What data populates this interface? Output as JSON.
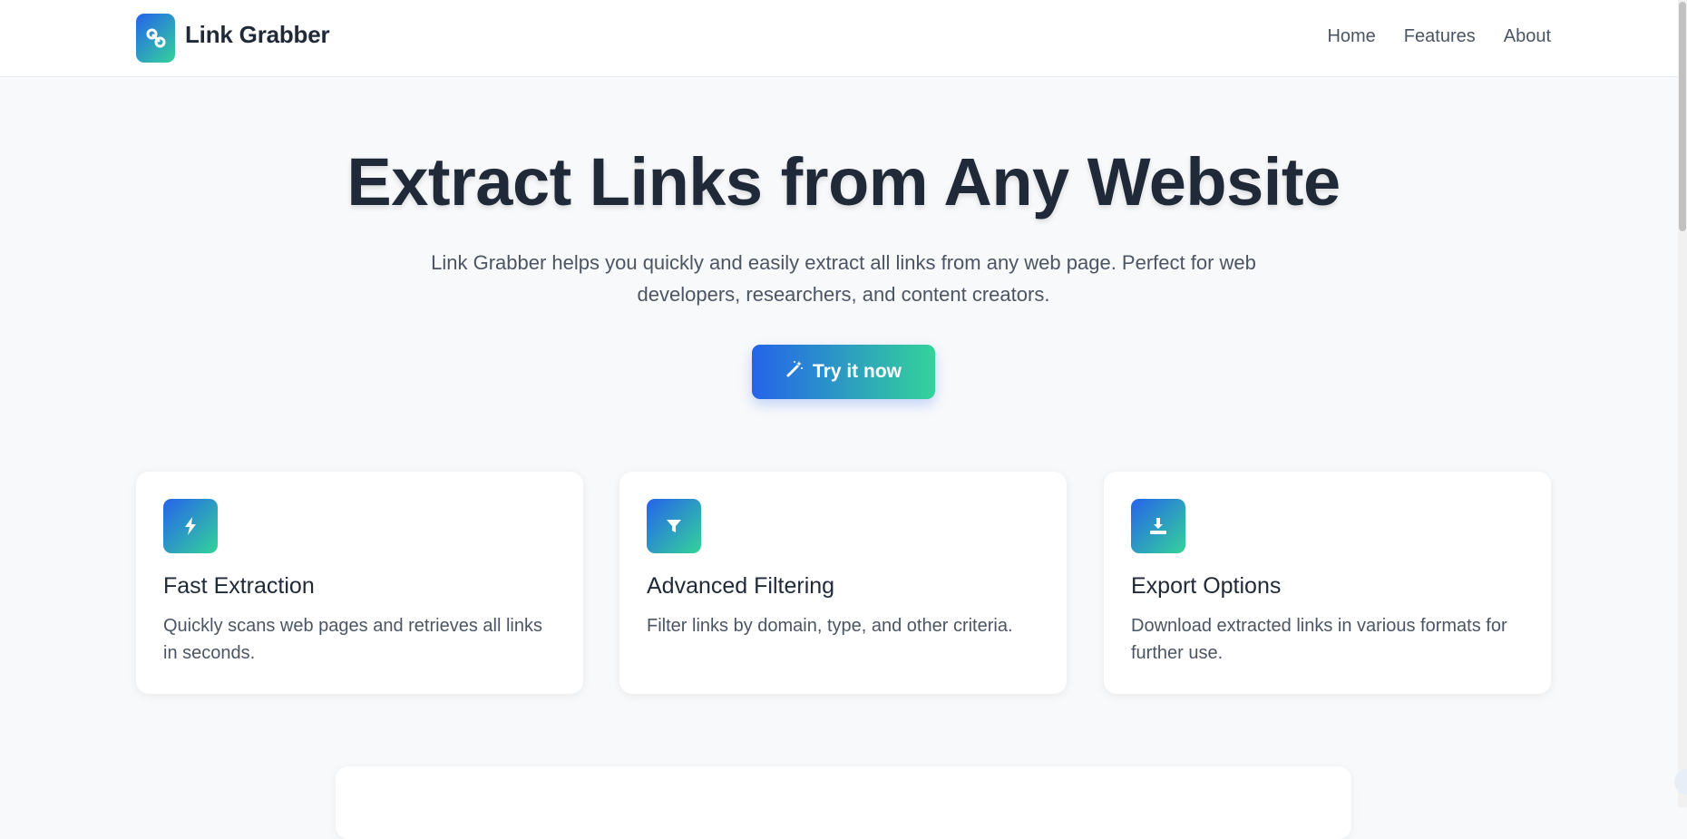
{
  "brand": {
    "name": "Link Grabber",
    "icon": "link-icon"
  },
  "nav": {
    "items": [
      "Home",
      "Features",
      "About"
    ]
  },
  "hero": {
    "title": "Extract Links from Any Website",
    "subtitle": "Link Grabber helps you quickly and easily extract all links from any web page. Perfect for web developers, researchers, and content creators.",
    "cta_label": "Try it now",
    "cta_icon": "magic-wand-icon"
  },
  "features": [
    {
      "icon": "bolt-icon",
      "title": "Fast Extraction",
      "desc": "Quickly scans web pages and retrieves all links in seconds."
    },
    {
      "icon": "filter-icon",
      "title": "Advanced Filtering",
      "desc": "Filter links by domain, type, and other criteria."
    },
    {
      "icon": "download-icon",
      "title": "Export Options",
      "desc": "Download extracted links in various formats for further use."
    }
  ],
  "colors": {
    "gradient_start": "#2563eb",
    "gradient_end": "#34d399",
    "text_dark": "#1f2937",
    "text_muted": "#4b5563",
    "page_bg": "#f8f9fb"
  }
}
